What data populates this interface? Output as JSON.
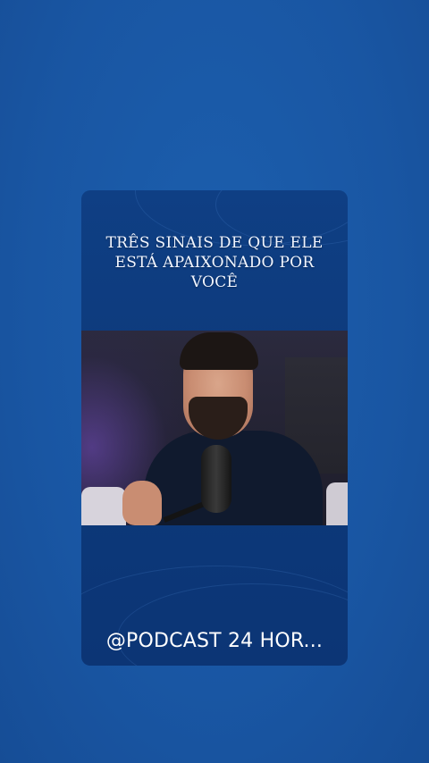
{
  "post": {
    "title_lines": [
      "TRÊS SINAIS DE QUE ELE",
      "ESTÁ APAIXONADO POR",
      "VOCÊ"
    ],
    "video_subject": "man-speaking-into-podcast-microphone",
    "handle": "@PODCAST 24 HOR..."
  },
  "colors": {
    "page_background": "#1a5aa8",
    "card_background": "#0e3b7e",
    "text": "#ffffff"
  }
}
